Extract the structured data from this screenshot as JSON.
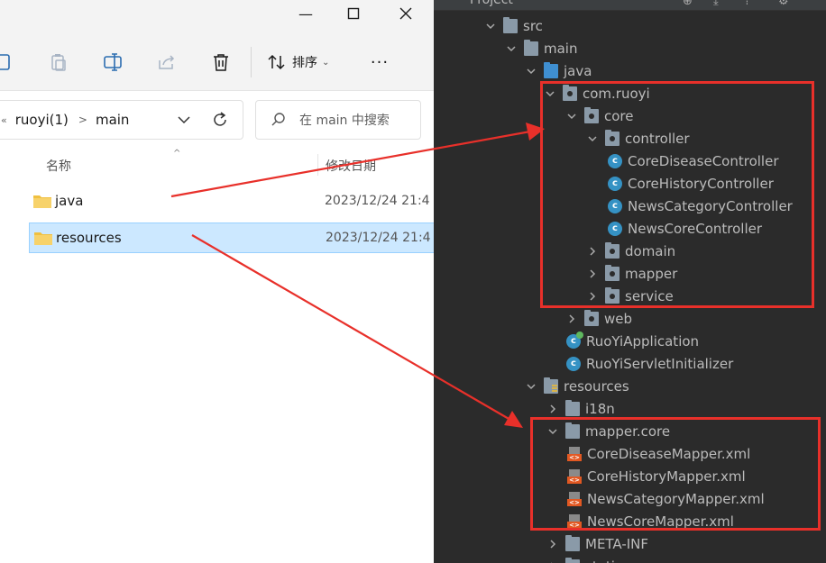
{
  "explorer": {
    "window": {
      "minimize": "—",
      "maximize": "☐",
      "close": "✕"
    },
    "toolbar": {
      "sort_label": "排序",
      "more_label": "···",
      "icons": [
        "copy-icon",
        "paste-icon",
        "rename-icon",
        "share-icon",
        "delete-icon",
        "sort-icon"
      ]
    },
    "address": {
      "crumbs": [
        "ruoyi(1)",
        "main"
      ],
      "overflow": "«",
      "sep": ">"
    },
    "search": {
      "placeholder": "在 main 中搜索"
    },
    "columns": {
      "name": "名称",
      "date": "修改日期"
    },
    "rows": [
      {
        "name": "java",
        "date": "2023/12/24 21:4",
        "selected": false
      },
      {
        "name": "resources",
        "date": "2023/12/24 21:4",
        "selected": true
      }
    ]
  },
  "ide": {
    "header": {
      "title": "Project"
    },
    "tree": [
      {
        "label": "src",
        "kind": "folder",
        "state": "open"
      },
      {
        "label": "main",
        "kind": "folder",
        "state": "open"
      },
      {
        "label": "java",
        "kind": "source-root",
        "state": "open"
      },
      {
        "label": "com.ruoyi",
        "kind": "package",
        "state": "open"
      },
      {
        "label": "core",
        "kind": "package",
        "state": "open"
      },
      {
        "label": "controller",
        "kind": "package",
        "state": "open"
      },
      {
        "label": "CoreDiseaseController",
        "kind": "class"
      },
      {
        "label": "CoreHistoryController",
        "kind": "class"
      },
      {
        "label": "NewsCategoryController",
        "kind": "class"
      },
      {
        "label": "NewsCoreController",
        "kind": "class"
      },
      {
        "label": "domain",
        "kind": "package",
        "state": "closed"
      },
      {
        "label": "mapper",
        "kind": "package",
        "state": "closed"
      },
      {
        "label": "service",
        "kind": "package",
        "state": "closed"
      },
      {
        "label": "web",
        "kind": "package",
        "state": "closed"
      },
      {
        "label": "RuoYiApplication",
        "kind": "app-class"
      },
      {
        "label": "RuoYiServletInitializer",
        "kind": "class"
      },
      {
        "label": "resources",
        "kind": "resources-root",
        "state": "open"
      },
      {
        "label": "i18n",
        "kind": "folder",
        "state": "closed"
      },
      {
        "label": "mapper.core",
        "kind": "folder",
        "state": "open"
      },
      {
        "label": "CoreDiseaseMapper.xml",
        "kind": "xml"
      },
      {
        "label": "CoreHistoryMapper.xml",
        "kind": "xml"
      },
      {
        "label": "NewsCategoryMapper.xml",
        "kind": "xml"
      },
      {
        "label": "NewsCoreMapper.xml",
        "kind": "xml"
      },
      {
        "label": "META-INF",
        "kind": "folder",
        "state": "closed"
      },
      {
        "label": "static",
        "kind": "folder",
        "state": "closed"
      }
    ]
  },
  "colors": {
    "annotation_red": "#e8302a",
    "selection_blue": "#cce8ff",
    "class_icon": "#3592c4",
    "xml_icon": "#e25822"
  }
}
